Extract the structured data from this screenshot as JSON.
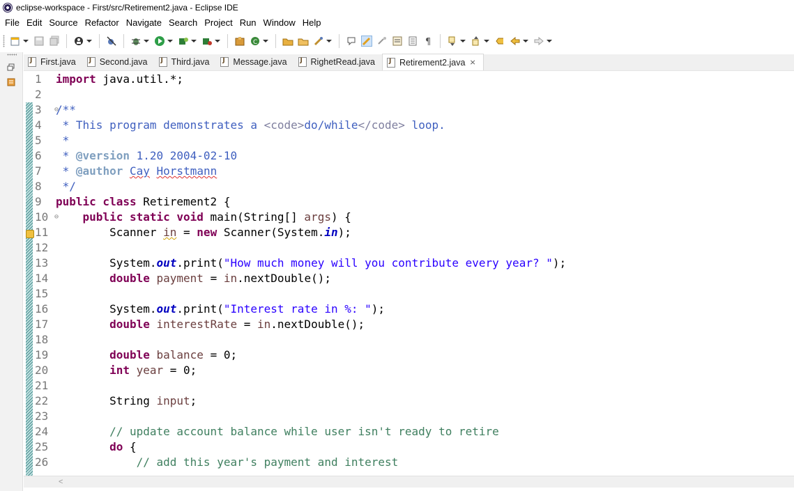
{
  "window": {
    "title": "eclipse-workspace - First/src/Retirement2.java - Eclipse IDE"
  },
  "menu": [
    "File",
    "Edit",
    "Source",
    "Refactor",
    "Navigate",
    "Search",
    "Project",
    "Run",
    "Window",
    "Help"
  ],
  "toolbar": {
    "icons": [
      "new-icon",
      "save-icon",
      "save-all-icon",
      "profile-icon",
      "skip-breakpoints-icon",
      "debug-icon",
      "run-icon",
      "coverage-icon",
      "external-tools-icon",
      "new-java-package-icon",
      "new-java-class-icon",
      "open-type-icon",
      "open-folder-icon",
      "search-icon",
      "toggle-annotation-icon",
      "mark-occurrences-icon",
      "block-selection-icon",
      "show-whitespace-icon",
      "next-annotation-icon",
      "prev-annotation-icon",
      "last-edit-icon",
      "back-icon",
      "forward-icon"
    ]
  },
  "tabs": [
    {
      "label": "First.java",
      "active": false
    },
    {
      "label": "Second.java",
      "active": false
    },
    {
      "label": "Third.java",
      "active": false
    },
    {
      "label": "Message.java",
      "active": false
    },
    {
      "label": "RighetRead.java",
      "active": false
    },
    {
      "label": "Retirement2.java",
      "active": true,
      "close": "⨯"
    }
  ],
  "editor": {
    "lines": [
      "1",
      "2",
      "3",
      "4",
      "5",
      "6",
      "7",
      "8",
      "9",
      "10",
      "11",
      "12",
      "13",
      "14",
      "15",
      "16",
      "17",
      "18",
      "19",
      "20",
      "21",
      "22",
      "23",
      "24",
      "25",
      "26"
    ],
    "fold_marker": "⊖",
    "code": {
      "l1_import": "import",
      "l1_rest": " java.util.*;",
      "l3": "/**",
      "l4": " * This program demonstrates a ",
      "l4_tag1": "<code>",
      "l4_mid": "do/while",
      "l4_tag2": "</code>",
      "l4_end": " loop.",
      "l5": " *",
      "l6_star": " * ",
      "l6_tag": "@version",
      "l6_rest": " 1.20 2004-02-10",
      "l7_star": " * ",
      "l7_tag": "@author",
      "l7_sp": " ",
      "l7_first": "Cay",
      "l7_sp2": " ",
      "l7_last": "Horstmann",
      "l8": " */",
      "l9_kw": "public class",
      "l9_rest": " Retirement2 {",
      "l10_indent": "    ",
      "l10_kw": "public static void",
      "l10_a": " main(String[] ",
      "l10_args": "args",
      "l10_b": ") {",
      "l11_indent": "        ",
      "l11_a": "Scanner ",
      "l11_in": "in",
      "l11_b": " = ",
      "l11_new": "new",
      "l11_c": " Scanner(System.",
      "l11_fin": "in",
      "l11_d": ");",
      "l13_indent": "        ",
      "l13_a": "System.",
      "l13_out": "out",
      "l13_b": ".print(",
      "l13_str": "\"How much money will you contribute every year? \"",
      "l13_c": ");",
      "l14_indent": "        ",
      "l14_kw": "double",
      "l14_sp": " ",
      "l14_var": "payment",
      "l14_b": " = ",
      "l14_in": "in",
      "l14_c": ".nextDouble();",
      "l16_indent": "        ",
      "l16_a": "System.",
      "l16_out": "out",
      "l16_b": ".print(",
      "l16_str": "\"Interest rate in %: \"",
      "l16_c": ");",
      "l17_indent": "        ",
      "l17_kw": "double",
      "l17_sp": " ",
      "l17_var": "interestRate",
      "l17_b": " = ",
      "l17_in": "in",
      "l17_c": ".nextDouble();",
      "l19_indent": "        ",
      "l19_kw": "double",
      "l19_sp": " ",
      "l19_var": "balance",
      "l19_b": " = 0;",
      "l20_indent": "        ",
      "l20_kw": "int",
      "l20_sp": " ",
      "l20_var": "year",
      "l20_b": " = 0;",
      "l22_indent": "        ",
      "l22_a": "String ",
      "l22_var": "input",
      "l22_b": ";",
      "l24_indent": "        ",
      "l24_cm": "// update account balance while user isn't ready to retire",
      "l25_indent": "        ",
      "l25_kw": "do",
      "l25_b": " {",
      "l26_indent": "            ",
      "l26_cm": "// add this year's payment and interest"
    }
  },
  "scrollbar": {
    "left_arrow": "<"
  },
  "colors": {
    "keyword": "#7f0055",
    "javadoc": "#3f5fbf",
    "comment": "#3f7f5f",
    "string": "#2a00ff",
    "local_var": "#6a3e3e",
    "field": "#0000c0"
  }
}
